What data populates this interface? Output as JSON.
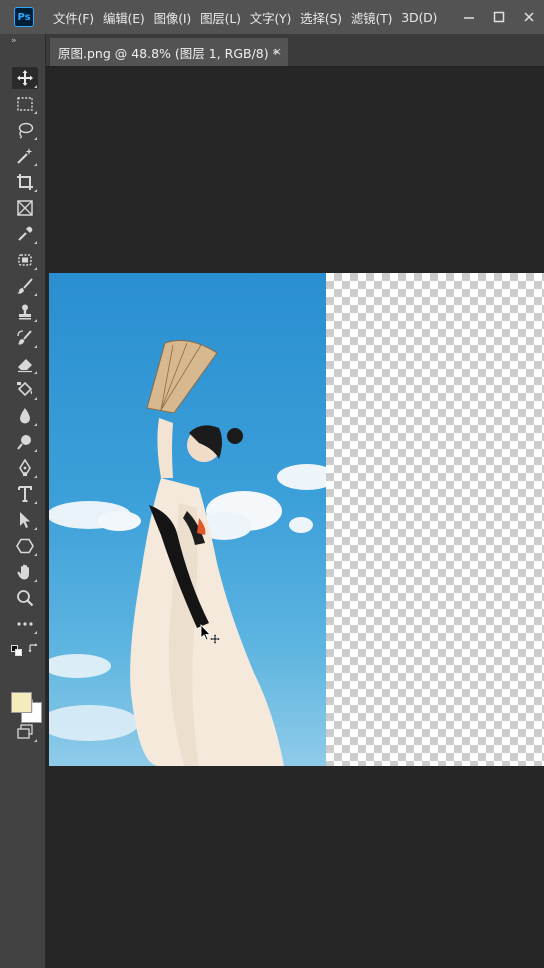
{
  "app": {
    "logo_text": "Ps"
  },
  "menu": {
    "items": [
      "文件(F)",
      "编辑(E)",
      "图像(I)",
      "图层(L)",
      "文字(Y)",
      "选择(S)",
      "滤镜(T)",
      "3D(D)"
    ]
  },
  "toolbar": {
    "collapse_glyph": "»",
    "tools": [
      {
        "name": "move-tool",
        "icon": "move-icon"
      },
      {
        "name": "marquee-tool",
        "icon": "rect-marquee-icon"
      },
      {
        "name": "lasso-tool",
        "icon": "lasso-icon"
      },
      {
        "name": "magic-wand-tool",
        "icon": "magic-wand-icon"
      },
      {
        "name": "crop-tool",
        "icon": "crop-icon"
      },
      {
        "name": "frame-tool",
        "icon": "frame-icon"
      },
      {
        "name": "eyedropper-tool",
        "icon": "eyedropper-icon"
      },
      {
        "name": "spot-healing-tool",
        "icon": "bandage-icon"
      },
      {
        "name": "brush-tool",
        "icon": "brush-icon"
      },
      {
        "name": "stamp-tool",
        "icon": "stamp-icon"
      },
      {
        "name": "history-brush-tool",
        "icon": "history-brush-icon"
      },
      {
        "name": "eraser-tool",
        "icon": "eraser-icon"
      },
      {
        "name": "gradient-tool",
        "icon": "paint-bucket-icon"
      },
      {
        "name": "blur-tool",
        "icon": "drop-icon"
      },
      {
        "name": "dodge-tool",
        "icon": "dodge-icon"
      },
      {
        "name": "pen-tool",
        "icon": "pen-icon"
      },
      {
        "name": "type-tool",
        "icon": "type-icon"
      },
      {
        "name": "path-selection-tool",
        "icon": "arrow-icon"
      },
      {
        "name": "shape-tool",
        "icon": "hexagon-icon"
      },
      {
        "name": "hand-tool",
        "icon": "hand-icon"
      },
      {
        "name": "zoom-tool",
        "icon": "zoom-icon"
      },
      {
        "name": "edit-toolbar",
        "icon": "more-icon"
      }
    ],
    "foreground_color": "#f6ebbd",
    "background_color": "#ffffff"
  },
  "document": {
    "tab_title": "原图.png @ 48.8% (图层 1, RGB/8) *",
    "close_glyph": "×"
  },
  "colors": {
    "menubar": "#535353",
    "toolbar": "#424242",
    "canvas_bg": "#262626",
    "accent": "#31a8ff"
  }
}
